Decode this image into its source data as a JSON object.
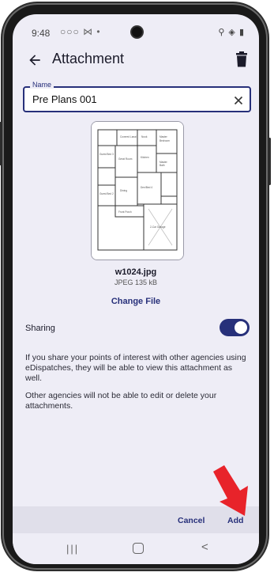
{
  "status_bar": {
    "time": "9:48",
    "notification_icons": "○○○ ⋈ •",
    "system_icons": "⚲ ◈ ▮"
  },
  "app_bar": {
    "title": "Attachment",
    "back_icon": "arrow-back-icon",
    "delete_icon": "trash-icon"
  },
  "name_field": {
    "label": "Name",
    "value": "Pre Plans 001",
    "clear_icon": "close-icon"
  },
  "attachment": {
    "file_name": "w1024.jpg",
    "file_meta": "JPEG 135 kB",
    "change_file_label": "Change File"
  },
  "sharing": {
    "label": "Sharing",
    "enabled": true,
    "toggle_color": "#27307a"
  },
  "info": {
    "paragraph_1": "If you share your points of interest with other agencies using eDispatches, they will be able to view this attachment as well.",
    "paragraph_2": "Other agencies will not be able to edit or delete your attachments."
  },
  "actions": {
    "cancel_label": "Cancel",
    "add_label": "Add"
  },
  "colors": {
    "accent": "#27307a",
    "screen_bg": "#eeedf6",
    "annotation_arrow": "#e8232a"
  }
}
